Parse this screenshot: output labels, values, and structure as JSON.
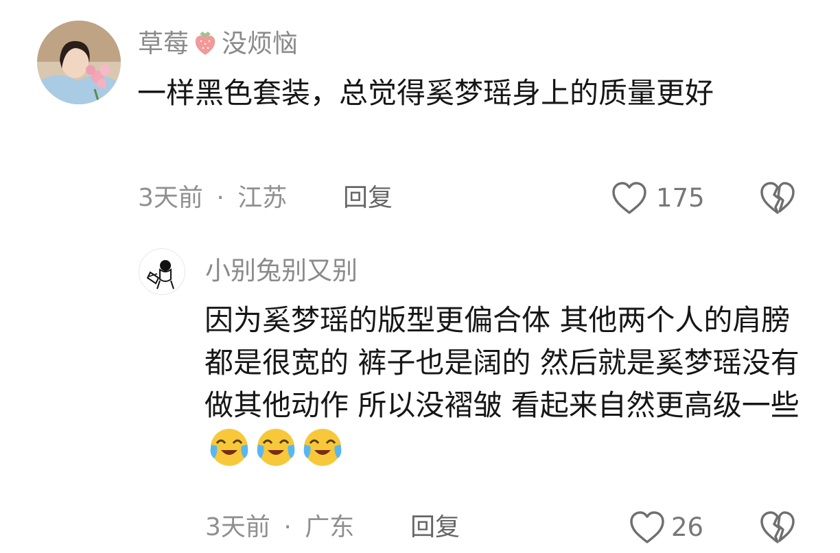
{
  "comments": [
    {
      "username": "草莓",
      "username_emoji": "strawberry-icon",
      "username_suffix": "没烦恼",
      "content": "一样黑色套装，总觉得奚梦瑶身上的质量更好",
      "time": "3天前",
      "separator": "·",
      "location": "江苏",
      "reply_label": "回复",
      "likes": "175"
    },
    {
      "username": "小别兔别又别",
      "content": "因为奚梦瑶的版型更偏合体  其他两个人的肩膀都是很宽的  裤子也是阔的  然后就是奚梦瑶没有做其他动作  所以没褶皱  看起来自然更高级一些",
      "content_emojis": [
        "crying-laughing-icon",
        "crying-laughing-icon",
        "crying-laughing-icon"
      ],
      "time": "3天前",
      "separator": "·",
      "location": "广东",
      "reply_label": "回复",
      "likes": "26"
    }
  ]
}
